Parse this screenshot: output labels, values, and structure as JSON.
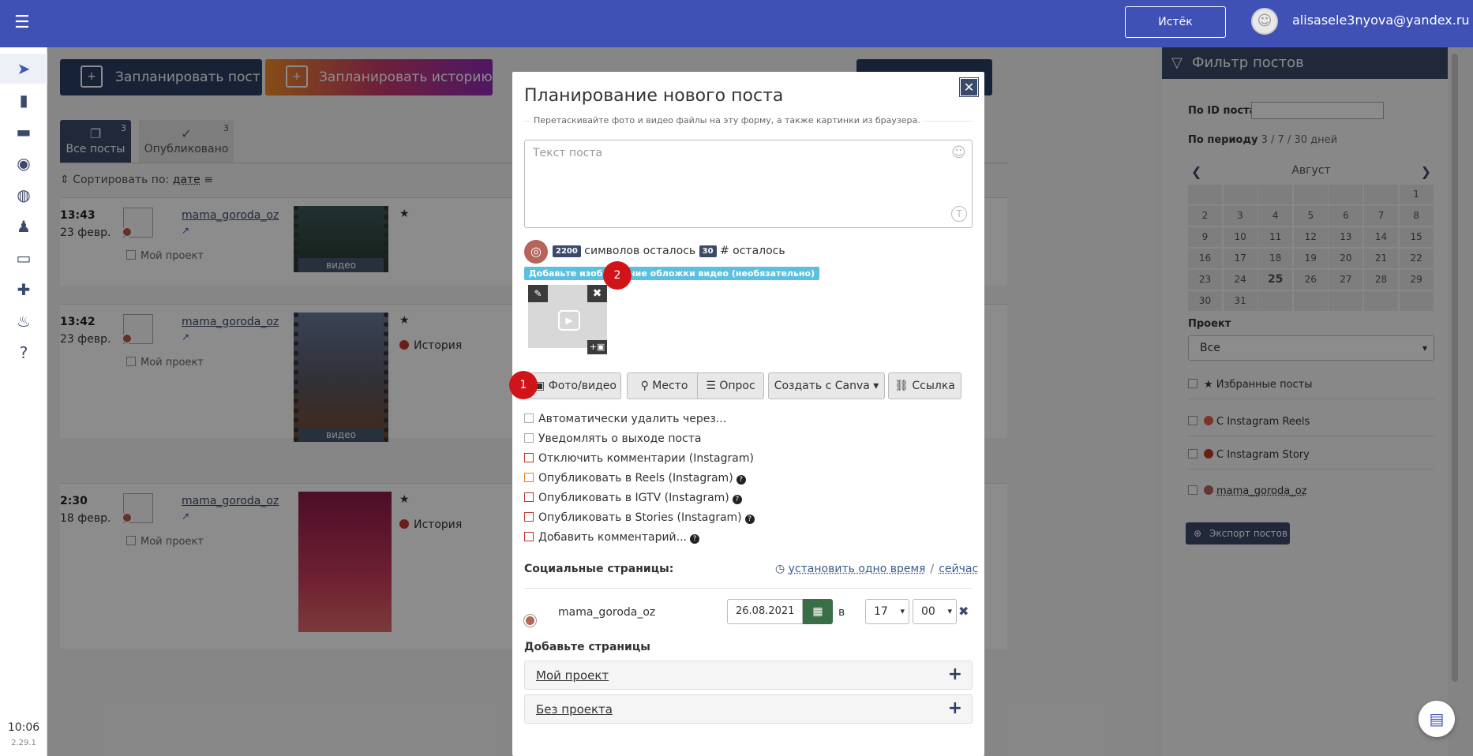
{
  "topbar": {
    "expired_label": "Истёк",
    "user_email": "alisasele3nyova@yandex.ru"
  },
  "sidebar": {
    "time": "10:06",
    "version": "2.29.1",
    "icons": [
      "send-icon",
      "bar-chart-icon",
      "folder-icon",
      "broadcast-icon",
      "globe-icon",
      "users-icon",
      "credit-card-icon",
      "add-user-icon",
      "fire-icon",
      "help-icon"
    ]
  },
  "main": {
    "plan_post_label": "Запланировать пост",
    "plan_story_label": "Запланировать историю",
    "tabs": [
      {
        "label": "Все посты",
        "count": "3"
      },
      {
        "label": "Опубликовано",
        "count": "3"
      }
    ],
    "sort_label": "Сортировать по:",
    "sort_value": "дате",
    "posts": [
      {
        "time": "13:43",
        "date": "23 февр.",
        "account": "mama_goroda_oz",
        "project": "Мой проект",
        "thumb_label": "видео",
        "tag": ""
      },
      {
        "time": "13:42",
        "date": "23 февр.",
        "account": "mama_goroda_oz",
        "project": "Мой проект",
        "thumb_label": "видео",
        "tag": "История"
      },
      {
        "time": "2:30",
        "date": "18 февр.",
        "account": "mama_goroda_oz",
        "project": "Мой проект",
        "thumb_label": "",
        "tag": "История"
      }
    ]
  },
  "filter": {
    "title": "Фильтр постов",
    "post_id_label": "По ID поста",
    "period_label": "По периоду",
    "period_values": "3 / 7 / 30 дней",
    "month": "Август",
    "calendar": [
      "",
      "",
      "",
      "",
      "",
      "",
      "1",
      "2",
      "3",
      "4",
      "5",
      "6",
      "7",
      "8",
      "9",
      "10",
      "11",
      "12",
      "13",
      "14",
      "15",
      "16",
      "17",
      "18",
      "19",
      "20",
      "21",
      "22",
      "23",
      "24",
      "25",
      "26",
      "27",
      "28",
      "29",
      "30",
      "31",
      "",
      "",
      "",
      "",
      ""
    ],
    "today": "25",
    "project_label": "Проект",
    "project_value": "Все",
    "checks": [
      {
        "label": "Избранные посты"
      },
      {
        "label": "С Instagram Reels"
      },
      {
        "label": "С Instagram Story"
      },
      {
        "label": "mama_goroda_oz"
      }
    ],
    "export_label": "Экспорт постов"
  },
  "modal": {
    "title": "Планирование нового поста",
    "hint": "Перетаскивайте фото и видео файлы на эту форму, а также картинки из браузера.",
    "text_placeholder": "Текст поста",
    "chars_left": "2200",
    "chars_left_label": "символов осталось",
    "tags_left": "30",
    "tags_left_label": "# осталось",
    "cover_tag": "Добавьте изображение обложки видео (необязательно)",
    "markers": [
      "1",
      "2"
    ],
    "tools": {
      "photo": "Фото/видео",
      "place": "Место",
      "poll": "Опрос",
      "canva": "Создать с Canva",
      "link": "Ссылка"
    },
    "options": [
      "Автоматически удалить через...",
      "Уведомлять о выходе поста",
      "Отключить комментарии (Instagram)",
      "Опубликовать в Reels (Instagram)",
      "Опубликовать в IGTV (Instagram)",
      "Опубликовать в Stories (Instagram)",
      "Добавить комментарий..."
    ],
    "social_label": "Социальные страницы:",
    "set_one_time": "установить одно время",
    "now": "сейчас",
    "account": "mama_goroda_oz",
    "date": "26.08.2021",
    "at_label": "в",
    "hour": "17",
    "minute": "00",
    "add_pages": "Добавьте страницы",
    "projects": [
      "Мой проект",
      "Без проекта"
    ]
  }
}
